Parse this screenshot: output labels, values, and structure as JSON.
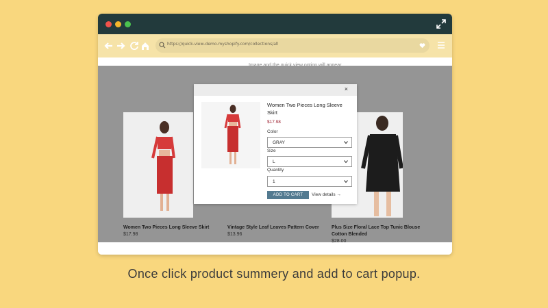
{
  "browser": {
    "url": "https://quick-view-demo.myshopify.com/collections/all"
  },
  "page": {
    "hint_text": "Image and the quick view option will appear."
  },
  "products": [
    {
      "name": "Women Two Pieces Long Sleeve Skirt",
      "price": "$17.98"
    },
    {
      "name": "Vintage Style Leaf Leaves Pattern Cover",
      "price": "$13.96"
    },
    {
      "name": "Plus Size Floral Lace Top Tunic Blouse Cotton Blended",
      "price": "$28.00"
    }
  ],
  "modal": {
    "close_label": "×",
    "title": "Women Two Pieces Long Sleeve Skirt",
    "price": "$17.98",
    "color_label": "Color",
    "color_value": "GRAY",
    "size_label": "Size",
    "size_value": "L",
    "quantity_label": "Quantity",
    "quantity_value": "1",
    "add_to_cart_label": "ADD TO CART",
    "view_details_label": "View details →"
  },
  "caption": "Once click product summery and add to cart popup.",
  "colors": {
    "background": "#f9d77e",
    "titlebar": "#223a3c",
    "toolbar": "#f6e3a8",
    "button": "#537a90",
    "price_accent": "#9b1b2b"
  }
}
